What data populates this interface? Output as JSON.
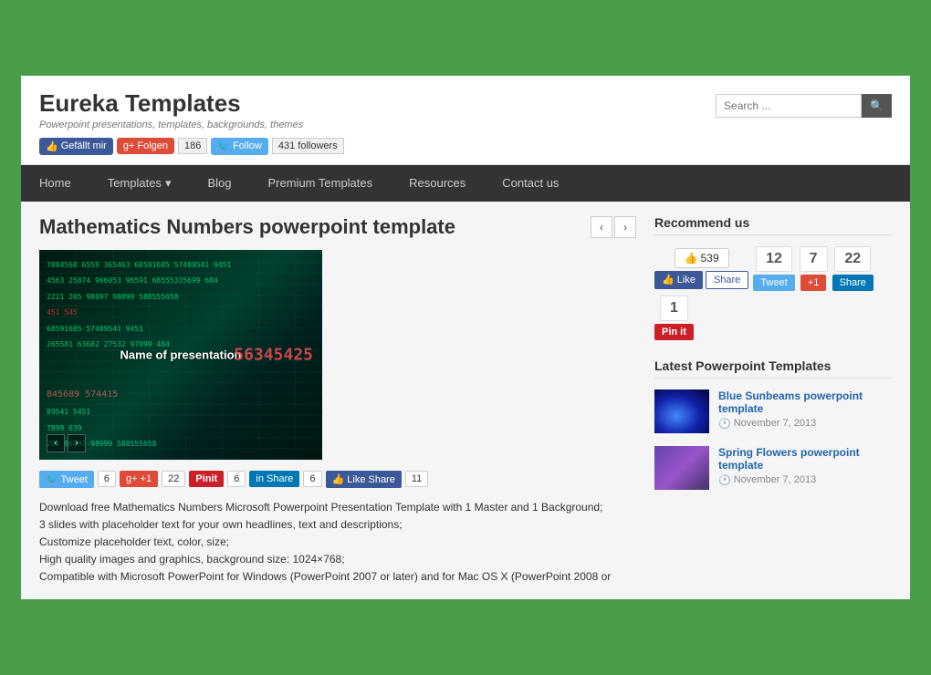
{
  "site": {
    "title": "Eureka Templates",
    "subtitle": "Powerpoint presentations, templates, backgrounds, themes"
  },
  "header": {
    "search_placeholder": "Search ...",
    "social": {
      "fb_label": "Gefällt mir",
      "gplus_label": "Folgen",
      "gplus_count": "186",
      "twitter_label": "Follow",
      "twitter_followers": "431 followers"
    }
  },
  "nav": {
    "items": [
      {
        "label": "Home",
        "active": false
      },
      {
        "label": "Templates",
        "active": false,
        "has_arrow": true
      },
      {
        "label": "Blog",
        "active": false
      },
      {
        "label": "Premium Templates",
        "active": false
      },
      {
        "label": "Resources",
        "active": false
      },
      {
        "label": "Contact us",
        "active": false
      }
    ]
  },
  "article": {
    "title": "Mathematics Numbers powerpoint template",
    "center_text": "Name of presentation",
    "image_numbers": [
      "7884568  6559  365463  68591685  57489541  9451",
      "4563  25874  966053  96591  68555335699  684",
      "2221  205  98097 98099  588555658",
      "451 545",
      "68591685  57489541  9451",
      "265581  63682 27532 97099  484",
      "56345425",
      "845689  574415",
      "89541 5451",
      "7899  639",
      "205  98897-98999  588555658"
    ],
    "share": {
      "tweet_count": "6",
      "gplus_count": "22",
      "pinterest_count": "6",
      "linkedin_count": "6",
      "fb_count": "11"
    },
    "description": [
      "Download free Mathematics Numbers Microsoft Powerpoint Presentation Template with 1 Master and 1 Background;",
      "3 slides with placeholder text for your own headlines, text and descriptions;",
      "Customize placeholder text, color, size;",
      "High quality images and graphics, background size: 1024×768;",
      "Compatible with Microsoft PowerPoint for Windows (PowerPoint 2007 or later) and for Mac OS X (PowerPoint 2008 or"
    ]
  },
  "sidebar": {
    "recommend": {
      "title": "Recommend us",
      "like_count": "539",
      "tweet_count": "12",
      "gplus_count": "7",
      "linkedin_count": "22",
      "pin_count": "1"
    },
    "latest": {
      "title": "Latest Powerpoint Templates",
      "items": [
        {
          "title": "Blue Sunbeams powerpoint template",
          "date": "November 7, 2013",
          "thumb_type": "blue"
        },
        {
          "title": "Spring Flowers powerpoint template",
          "date": "November 7, 2013",
          "thumb_type": "purple"
        }
      ]
    }
  }
}
